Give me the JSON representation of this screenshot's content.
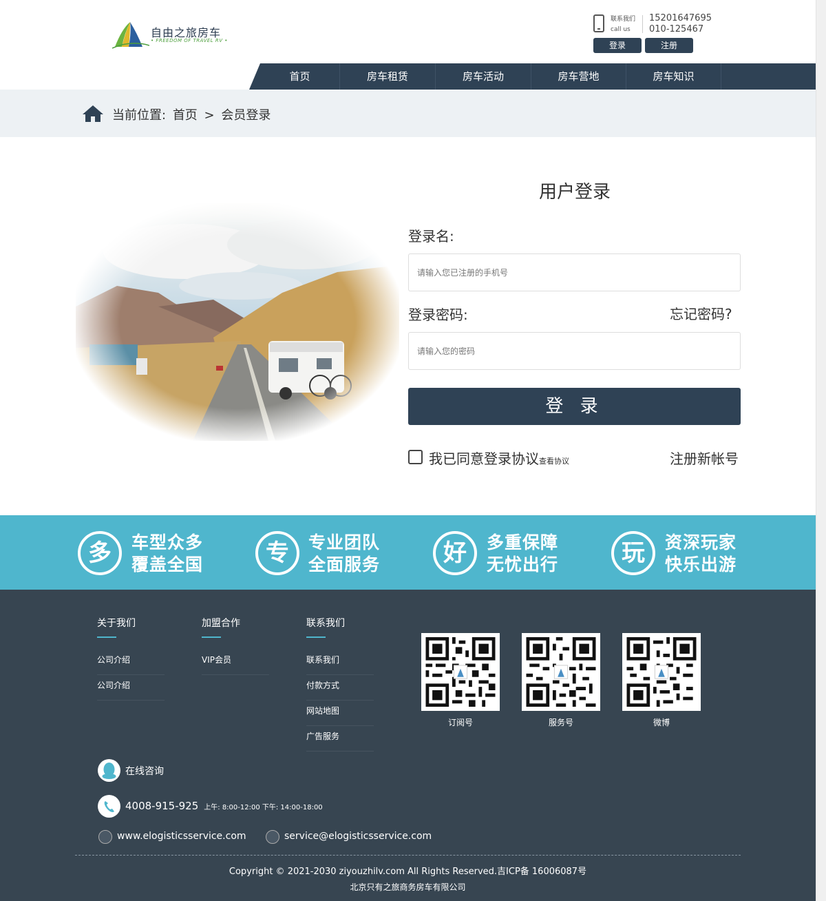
{
  "brand": {
    "name_cn": "自由之旅房车",
    "name_en": "• FREEDOM OF TRAVEL RV •"
  },
  "header": {
    "contact_label_cn": "联系我们",
    "contact_label_en": "call us",
    "phone1": "15201647695",
    "phone2": "010-125467",
    "login_label": "登录",
    "register_label": "注册"
  },
  "nav": {
    "items": [
      {
        "label": "首页"
      },
      {
        "label": "房车租赁"
      },
      {
        "label": "房车活动"
      },
      {
        "label": "房车营地"
      },
      {
        "label": "房车知识"
      }
    ]
  },
  "breadcrumb": {
    "prefix": "当前位置:",
    "home": "首页",
    "sep": ">",
    "current": "会员登录"
  },
  "login": {
    "title": "用户登录",
    "username_label": "登录名:",
    "username_placeholder": "请输入您已注册的手机号",
    "password_label": "登录密码:",
    "forgot": "忘记密码?",
    "password_placeholder": "请输入您的密码",
    "submit": "登 录",
    "agree": "我已同意登录协议",
    "view_agreement": "查看协议",
    "register_link": "注册新帐号"
  },
  "features": [
    {
      "char": "多",
      "line1": "车型众多",
      "line2": "覆盖全国"
    },
    {
      "char": "专",
      "line1": "专业团队",
      "line2": "全面服务"
    },
    {
      "char": "好",
      "line1": "多重保障",
      "line2": "无忧出行"
    },
    {
      "char": "玩",
      "line1": "资深玩家",
      "line2": "快乐出游"
    }
  ],
  "footer": {
    "columns": [
      {
        "title": "关于我们",
        "links": [
          "公司介绍",
          "公司介绍"
        ]
      },
      {
        "title": "加盟合作",
        "links": [
          "VIP会员"
        ]
      },
      {
        "title": "联系我们",
        "links": [
          "联系我们",
          "付款方式",
          "网站地图",
          "广告服务"
        ]
      }
    ],
    "qrcodes": [
      "订阅号",
      "服务号",
      "微博"
    ],
    "online": "在线咨询",
    "hotline": "4008-915-925",
    "hours": "上午: 8:00-12:00   下午: 14:00-18:00",
    "website": "www.elogisticsservice.com",
    "email": "service@elogisticsservice.com",
    "copyright": "Copyright © 2021-2030 ziyouzhilv.com All Rights Reserved.吉ICP备 16006087号",
    "company": "北京只有之旅商务房车有限公司"
  },
  "colors": {
    "navy": "#2f4255",
    "teal": "#4fb6cd",
    "footer": "#374551",
    "crumb_bg": "#edf1f4"
  }
}
